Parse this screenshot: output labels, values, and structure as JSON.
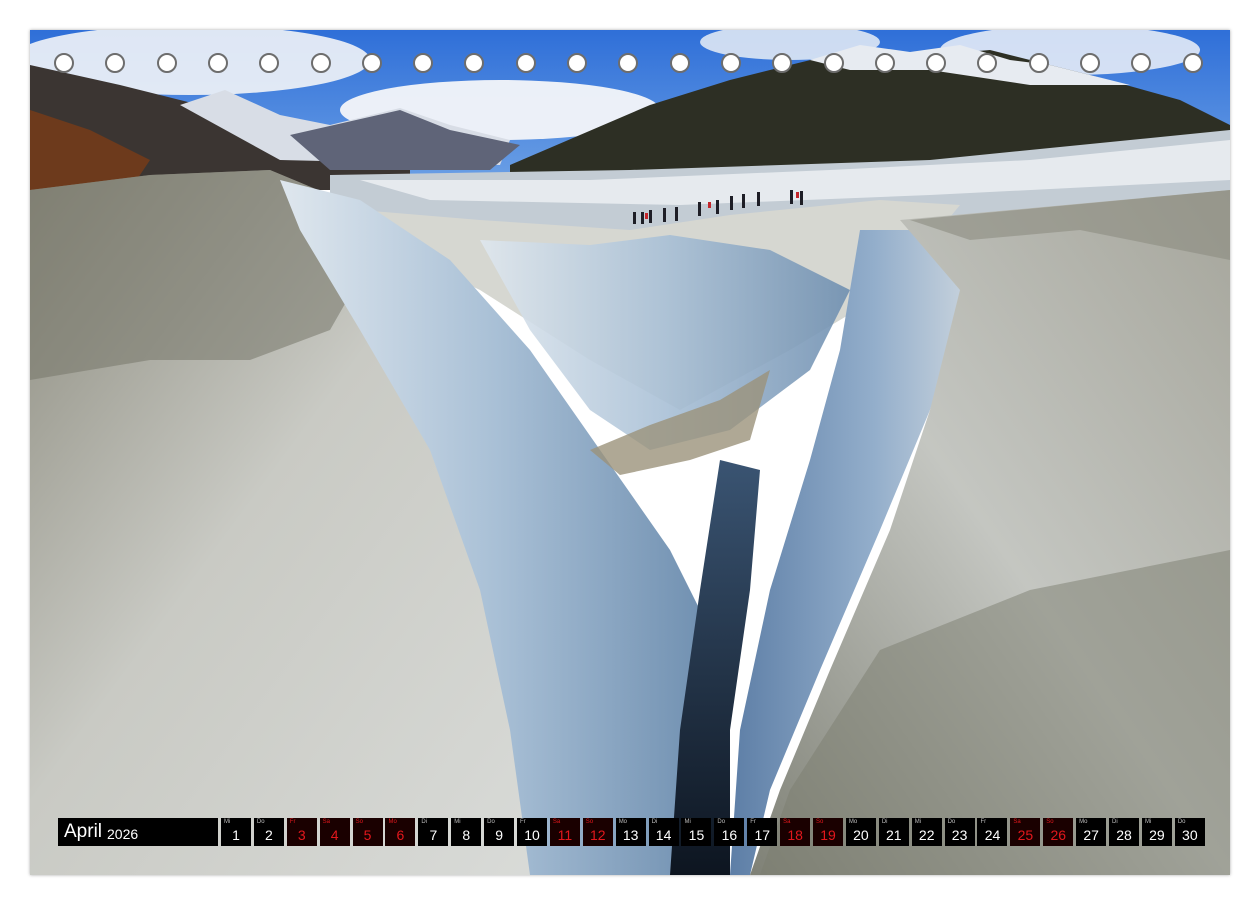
{
  "calendar": {
    "month": "April",
    "year": "2026",
    "days": [
      {
        "wd": "Mi",
        "n": "1",
        "we": false
      },
      {
        "wd": "Do",
        "n": "2",
        "we": false
      },
      {
        "wd": "Fr",
        "n": "3",
        "we": true
      },
      {
        "wd": "Sa",
        "n": "4",
        "we": true
      },
      {
        "wd": "So",
        "n": "5",
        "we": true
      },
      {
        "wd": "Mo",
        "n": "6",
        "we": true
      },
      {
        "wd": "Di",
        "n": "7",
        "we": false
      },
      {
        "wd": "Mi",
        "n": "8",
        "we": false
      },
      {
        "wd": "Do",
        "n": "9",
        "we": false
      },
      {
        "wd": "Fr",
        "n": "10",
        "we": false
      },
      {
        "wd": "Sa",
        "n": "11",
        "we": true
      },
      {
        "wd": "So",
        "n": "12",
        "we": true
      },
      {
        "wd": "Mo",
        "n": "13",
        "we": false
      },
      {
        "wd": "Di",
        "n": "14",
        "we": false
      },
      {
        "wd": "Mi",
        "n": "15",
        "we": false
      },
      {
        "wd": "Do",
        "n": "16",
        "we": false
      },
      {
        "wd": "Fr",
        "n": "17",
        "we": false
      },
      {
        "wd": "Sa",
        "n": "18",
        "we": true
      },
      {
        "wd": "So",
        "n": "19",
        "we": true
      },
      {
        "wd": "Mo",
        "n": "20",
        "we": false
      },
      {
        "wd": "Di",
        "n": "21",
        "we": false
      },
      {
        "wd": "Mi",
        "n": "22",
        "we": false
      },
      {
        "wd": "Do",
        "n": "23",
        "we": false
      },
      {
        "wd": "Fr",
        "n": "24",
        "we": false
      },
      {
        "wd": "Sa",
        "n": "25",
        "we": true
      },
      {
        "wd": "So",
        "n": "26",
        "we": true
      },
      {
        "wd": "Mo",
        "n": "27",
        "we": false
      },
      {
        "wd": "Di",
        "n": "28",
        "we": false
      },
      {
        "wd": "Mi",
        "n": "29",
        "we": false
      },
      {
        "wd": "Do",
        "n": "30",
        "we": false
      }
    ]
  },
  "colors": {
    "weekend": "#e3171c",
    "bar": "#000000"
  }
}
